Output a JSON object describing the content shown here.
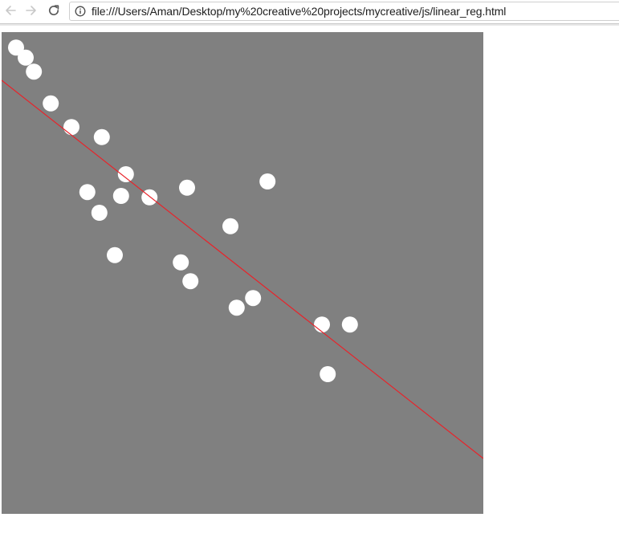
{
  "browser": {
    "url": "file:///Users/Aman/Desktop/my%20creative%20projects/mycreative/js/linear_reg.html",
    "back_icon": "arrow-left-icon",
    "forward_icon": "arrow-right-icon",
    "reload_icon": "reload-icon",
    "info_icon": "info-icon"
  },
  "sketch": {
    "background_color": "#808080",
    "point_color": "#ffffff",
    "line_color": "#e8232a",
    "regression_line": {
      "slope": -0.785,
      "intercept": 0.9
    },
    "points": [
      [
        0.03,
        0.968
      ],
      [
        0.05,
        0.947
      ],
      [
        0.067,
        0.918
      ],
      [
        0.102,
        0.852
      ],
      [
        0.145,
        0.803
      ],
      [
        0.208,
        0.782
      ],
      [
        0.258,
        0.705
      ],
      [
        0.178,
        0.668
      ],
      [
        0.248,
        0.66
      ],
      [
        0.307,
        0.657
      ],
      [
        0.385,
        0.677
      ],
      [
        0.552,
        0.69
      ],
      [
        0.203,
        0.625
      ],
      [
        0.475,
        0.597
      ],
      [
        0.235,
        0.537
      ],
      [
        0.372,
        0.522
      ],
      [
        0.392,
        0.483
      ],
      [
        0.522,
        0.448
      ],
      [
        0.488,
        0.428
      ],
      [
        0.665,
        0.393
      ],
      [
        0.723,
        0.393
      ],
      [
        0.677,
        0.29
      ]
    ]
  }
}
